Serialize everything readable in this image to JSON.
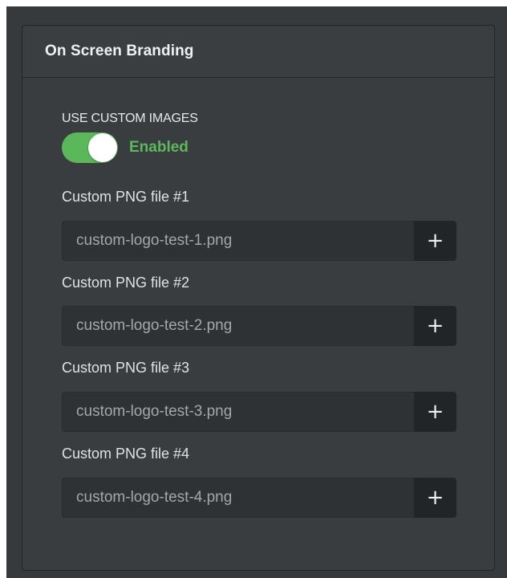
{
  "panel": {
    "title": "On Screen Branding"
  },
  "custom_images": {
    "label": "USE CUSTOM IMAGES",
    "toggle_on": true,
    "status": "Enabled",
    "status_color": "#5cb85c"
  },
  "files": [
    {
      "label": "Custom PNG file #1",
      "value": "custom-logo-test-1.png",
      "button": "+"
    },
    {
      "label": "Custom PNG file #2",
      "value": "custom-logo-test-2.png",
      "button": "+"
    },
    {
      "label": "Custom PNG file #3",
      "value": "custom-logo-test-3.png",
      "button": "+"
    },
    {
      "label": "Custom PNG file #4",
      "value": "custom-logo-test-4.png",
      "button": "+"
    }
  ],
  "colors": {
    "background": "#373a3d",
    "accent": "#5bb85a",
    "button": "#212527"
  }
}
